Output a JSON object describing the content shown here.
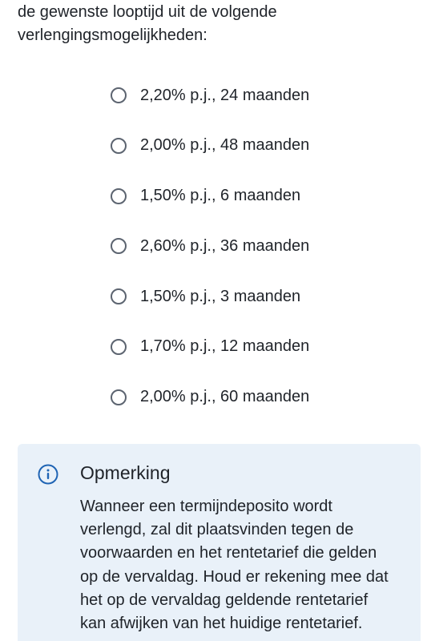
{
  "intro": {
    "line1": "de gewenste looptijd uit de volgende",
    "line2": "verlengingsmogelijkheden:"
  },
  "options": [
    {
      "label": "2,20% p.j., 24 maanden"
    },
    {
      "label": "2,00% p.j., 48 maanden"
    },
    {
      "label": "1,50% p.j., 6 maanden"
    },
    {
      "label": "2,60% p.j., 36 maanden"
    },
    {
      "label": "1,50% p.j., 3 maanden"
    },
    {
      "label": "1,70% p.j., 12 maanden"
    },
    {
      "label": "2,00% p.j., 60 maanden"
    }
  ],
  "note": {
    "icon": "info-icon",
    "title": "Opmerking",
    "lines": [
      "Wanneer een termijndeposito wordt",
      "verlengd, zal dit plaatsvinden tegen de",
      "voorwaarden en het rentetarief die gelden",
      "op de vervaldag. Houd er rekening mee dat",
      "het op de vervaldag geldende rentetarief",
      "kan afwijken van het huidige rentetarief."
    ]
  },
  "colors": {
    "text": "#1f2329",
    "radio_border": "#5c6470",
    "note_background": "#e9f1f9",
    "info_icon": "#1f64b4"
  }
}
